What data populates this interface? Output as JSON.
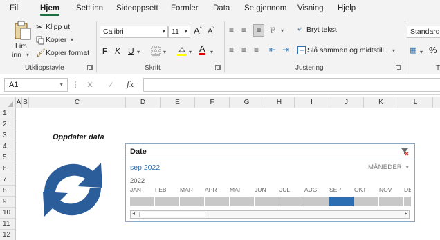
{
  "menu": {
    "tabs": [
      {
        "label": "Fil"
      },
      {
        "label": "Hjem",
        "active": true
      },
      {
        "label": "Sett inn"
      },
      {
        "label": "Sideoppsett"
      },
      {
        "label": "Formler"
      },
      {
        "label": "Data"
      },
      {
        "label": "Se gjennom"
      },
      {
        "label": "Visning"
      },
      {
        "label": "Hjelp"
      }
    ]
  },
  "ribbon": {
    "clipboard": {
      "paste_label_line1": "Lim",
      "paste_label_line2": "inn",
      "cut": "Klipp ut",
      "copy": "Kopier",
      "format_painter": "Kopier format",
      "group_label": "Utklippstavle"
    },
    "font": {
      "font_name": "Calibri",
      "font_size": "11",
      "bold": "F",
      "italic": "K",
      "underline": "U",
      "grow": "A",
      "shrink": "A",
      "font_color_letter": "A",
      "group_label": "Skrift"
    },
    "alignment": {
      "wrap_text": "Bryt tekst",
      "merge_center": "Slå sammen og midtstill",
      "group_label": "Justering"
    },
    "number": {
      "format": "Standard",
      "percent": "%",
      "group_label": "T"
    }
  },
  "formula_bar": {
    "name_box": "A1",
    "cancel_glyph": "✕",
    "enter_glyph": "✓",
    "fx_label": "fx"
  },
  "sheet": {
    "columns": [
      "A",
      "B",
      "C",
      "D",
      "E",
      "F",
      "G",
      "H",
      "I",
      "J",
      "K",
      "L"
    ],
    "rows": [
      "1",
      "2",
      "3",
      "4",
      "5",
      "6",
      "7",
      "8",
      "9",
      "10",
      "11",
      "12"
    ],
    "heading": "Oppdater data",
    "refresh_icon": "refresh-icon"
  },
  "timeline": {
    "title": "Date",
    "period": "sep 2022",
    "level": "MÅNEDER",
    "year": "2022",
    "months": [
      "JAN",
      "FEB",
      "MAR",
      "APR",
      "MAI",
      "JUN",
      "JUL",
      "AUG",
      "SEP",
      "OKT",
      "NOV",
      "DE"
    ],
    "selected_month": "SEP",
    "selection_color": "#2d6db2"
  },
  "colors": {
    "accent": "#1d6f42",
    "slicer_border": "#8aa9c6",
    "refresh_blue": "#2b5d9b"
  }
}
